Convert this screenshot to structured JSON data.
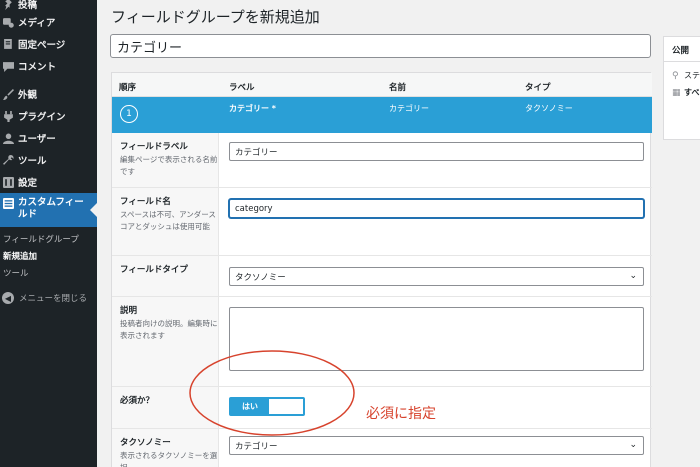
{
  "sidebar": {
    "items": [
      {
        "label": "投稿",
        "icon": "pin-icon"
      },
      {
        "label": "メディア",
        "icon": "media-icon"
      },
      {
        "label": "固定ページ",
        "icon": "page-icon"
      },
      {
        "label": "コメント",
        "icon": "comment-icon"
      },
      {
        "label": "外観",
        "icon": "brush-icon"
      },
      {
        "label": "プラグイン",
        "icon": "plugin-icon"
      },
      {
        "label": "ユーザー",
        "icon": "user-icon"
      },
      {
        "label": "ツール",
        "icon": "wrench-icon"
      },
      {
        "label": "設定",
        "icon": "settings-icon"
      },
      {
        "label": "カスタムフィールド",
        "icon": "acf-icon",
        "active": true
      }
    ],
    "submenu": [
      {
        "label": "フィールドグループ"
      },
      {
        "label": "新規追加",
        "current": true
      },
      {
        "label": "ツール"
      }
    ],
    "collapse_label": "メニューを閉じる"
  },
  "main": {
    "page_title": "フィールドグループを新規追加",
    "title_value": "カテゴリー",
    "columns": {
      "order": "順序",
      "label": "ラベル",
      "name": "名前",
      "type": "タイプ"
    },
    "field": {
      "order": "1",
      "label": "カテゴリー *",
      "name": "カテゴリー",
      "type": "タクソノミー"
    },
    "settings": {
      "field_label": {
        "title": "フィールドラベル",
        "desc": "編集ページで表示される名前です",
        "value": "カテゴリー"
      },
      "field_name": {
        "title": "フィールド名",
        "desc": "スペースは不可、アンダースコアとダッシュは使用可能",
        "value": "category"
      },
      "field_type": {
        "title": "フィールドタイプ",
        "value": "タクソノミー"
      },
      "instructions": {
        "title": "説明",
        "desc": "投稿者向けの説明。編集時に表示されます"
      },
      "required": {
        "title": "必須か？",
        "toggle_label": "はい",
        "value": true
      },
      "taxonomy": {
        "title": "タクソノミー",
        "desc": "表示されるタクソノミーを選択",
        "value": "カテゴリー"
      }
    },
    "annotation": "必須に指定",
    "annotation_color": "#d7432d"
  },
  "publish": {
    "title": "公開",
    "line1": "ステ",
    "line2": "すべ"
  },
  "colors": {
    "sidebar_bg": "#1d2327",
    "accent": "#2271b1",
    "field_row": "#2a9fd6"
  }
}
